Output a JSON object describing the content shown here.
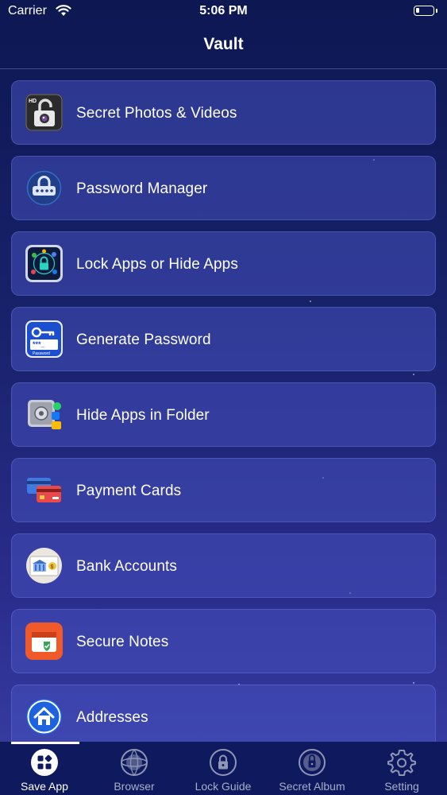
{
  "status_bar": {
    "carrier": "Carrier",
    "time": "5:06 PM",
    "battery_level_percent": 10
  },
  "nav": {
    "title": "Vault"
  },
  "menu_items": [
    {
      "label": "Secret Photos & Videos",
      "icon": "lock-camera-icon"
    },
    {
      "label": "Password Manager",
      "icon": "password-lock-icon"
    },
    {
      "label": "Lock Apps or Hide Apps",
      "icon": "app-lock-icon"
    },
    {
      "label": "Generate Password",
      "icon": "key-password-icon"
    },
    {
      "label": "Hide Apps in Folder",
      "icon": "safe-folder-icon"
    },
    {
      "label": "Payment Cards",
      "icon": "credit-card-icon"
    },
    {
      "label": "Bank Accounts",
      "icon": "bank-icon"
    },
    {
      "label": "Secure Notes",
      "icon": "secure-note-icon"
    },
    {
      "label": "Addresses",
      "icon": "home-icon"
    }
  ],
  "tabs": [
    {
      "label": "Save App",
      "icon": "grid-icon",
      "active": true
    },
    {
      "label": "Browser",
      "icon": "globe-icon",
      "active": false
    },
    {
      "label": "Lock Guide",
      "icon": "lock-icon",
      "active": false
    },
    {
      "label": "Secret Album",
      "icon": "padlock-dial-icon",
      "active": false
    },
    {
      "label": "Setting",
      "icon": "gear-icon",
      "active": false
    }
  ],
  "colors": {
    "background_top": "#0d1752",
    "background_bottom": "#3a3fa6",
    "row_background": "#4650be",
    "tab_bar": "#0f1a5e",
    "tab_inactive_text": "#a7aec8"
  }
}
